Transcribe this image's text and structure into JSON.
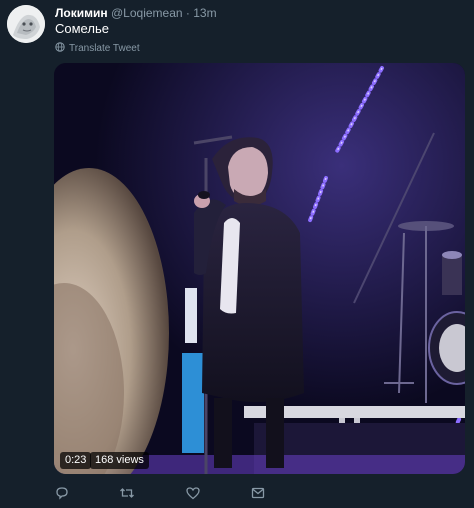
{
  "tweet": {
    "author_name": "Локимин",
    "author_handle": "@Loqiemean",
    "separator": "·",
    "time_ago": "13m",
    "text": "Сомелье",
    "translate_label": "Translate Tweet"
  },
  "media": {
    "duration": "0:23",
    "views": "168 views"
  },
  "actions": {
    "icons": [
      "reply-icon",
      "retweet-icon",
      "like-icon",
      "share-icon"
    ]
  },
  "colors": {
    "background": "#15202b",
    "secondary_text": "#8899a6",
    "stage_light": "#8c6dff"
  }
}
